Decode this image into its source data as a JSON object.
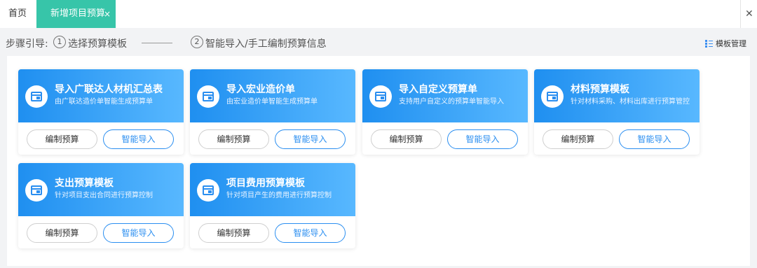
{
  "tabs": {
    "home": "首页",
    "active": "新增项目预算",
    "active_close": "×",
    "close_all": "✕"
  },
  "steps": {
    "label": "步骤引导:",
    "step1_num": "1",
    "step1_text": "选择预算模板",
    "step2_num": "2",
    "step2_text": "智能导入/手工编制预算信息"
  },
  "template_manage": "模板管理",
  "cards": [
    {
      "title": "导入广联达人材机汇总表",
      "desc": "由广联达造价单智能生成预算单",
      "edit": "编制预算",
      "import": "智能导入"
    },
    {
      "title": "导入宏业造价单",
      "desc": "由宏业造价单智能生成预算单",
      "edit": "编制预算",
      "import": "智能导入"
    },
    {
      "title": "导入自定义预算单",
      "desc": "支持用户自定义的预算单智能导入",
      "edit": "编制预算",
      "import": "智能导入"
    },
    {
      "title": "材料预算模板",
      "desc": "针对材料采购、材料出库进行预算管控",
      "edit": "编制预算",
      "import": "智能导入"
    },
    {
      "title": "支出预算模板",
      "desc": "针对项目支出合同进行预算控制",
      "edit": "编制预算",
      "import": "智能导入"
    },
    {
      "title": "项目费用预算模板",
      "desc": "针对项目产生的费用进行预算控制",
      "edit": "编制预算",
      "import": "智能导入"
    }
  ],
  "colors": {
    "tab_active": "#37c5a9",
    "card_gradient_start": "#1f8ff0",
    "card_gradient_end": "#58b8ff",
    "accent": "#2a8ef0"
  }
}
